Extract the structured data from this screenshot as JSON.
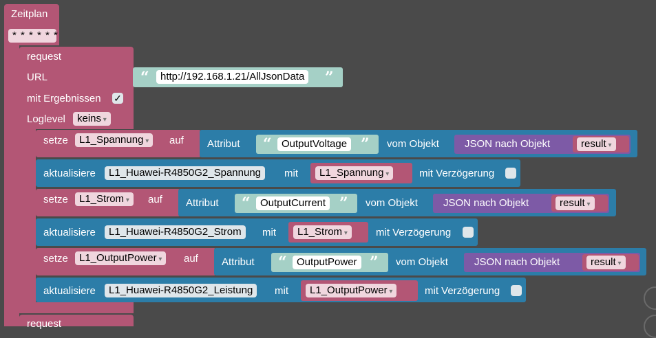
{
  "schedule": {
    "title": "Zeitplan",
    "pattern": "* * * * * *"
  },
  "request": {
    "title": "request",
    "url_label": "URL",
    "url_value": "http://192.168.1.21/AllJsonData",
    "with_results_label": "mit Ergebnissen",
    "with_results_checked": "✓",
    "loglevel_label": "Loglevel",
    "loglevel_value": "keins"
  },
  "rows": [
    {
      "set_label": "setze",
      "var": "L1_Spannung",
      "on": "auf",
      "attr_label": "Attribut",
      "attr": "OutputVoltage",
      "from": "vom Objekt",
      "json": "JSON nach Objekt",
      "result": "result"
    },
    {
      "update_label": "aktualisiere",
      "state": "L1_Huawei-R4850G2_Spannung",
      "with": "mit",
      "var": "L1_Spannung",
      "delay": "mit Verzögerung"
    },
    {
      "set_label": "setze",
      "var": "L1_Strom",
      "on": "auf",
      "attr_label": "Attribut",
      "attr": "OutputCurrent",
      "from": "vom Objekt",
      "json": "JSON nach Objekt",
      "result": "result"
    },
    {
      "update_label": "aktualisiere",
      "state": "L1_Huawei-R4850G2_Strom",
      "with": "mit",
      "var": "L1_Strom",
      "delay": "mit Verzögerung"
    },
    {
      "set_label": "setze",
      "var": "L1_OutputPower",
      "on": "auf",
      "attr_label": "Attribut",
      "attr": "OutputPower",
      "from": "vom Objekt",
      "json": "JSON nach Objekt",
      "result": "result"
    },
    {
      "update_label": "aktualisiere",
      "state": "L1_Huawei-R4850G2_Leistung",
      "with": "mit",
      "var": "L1_OutputPower",
      "delay": "mit Verzögerung"
    }
  ],
  "next_request": "request",
  "colors": {
    "pink": "#b35675",
    "blue": "#2c7da8",
    "teal": "#a5d0c6",
    "purple": "#7d5aa6"
  }
}
